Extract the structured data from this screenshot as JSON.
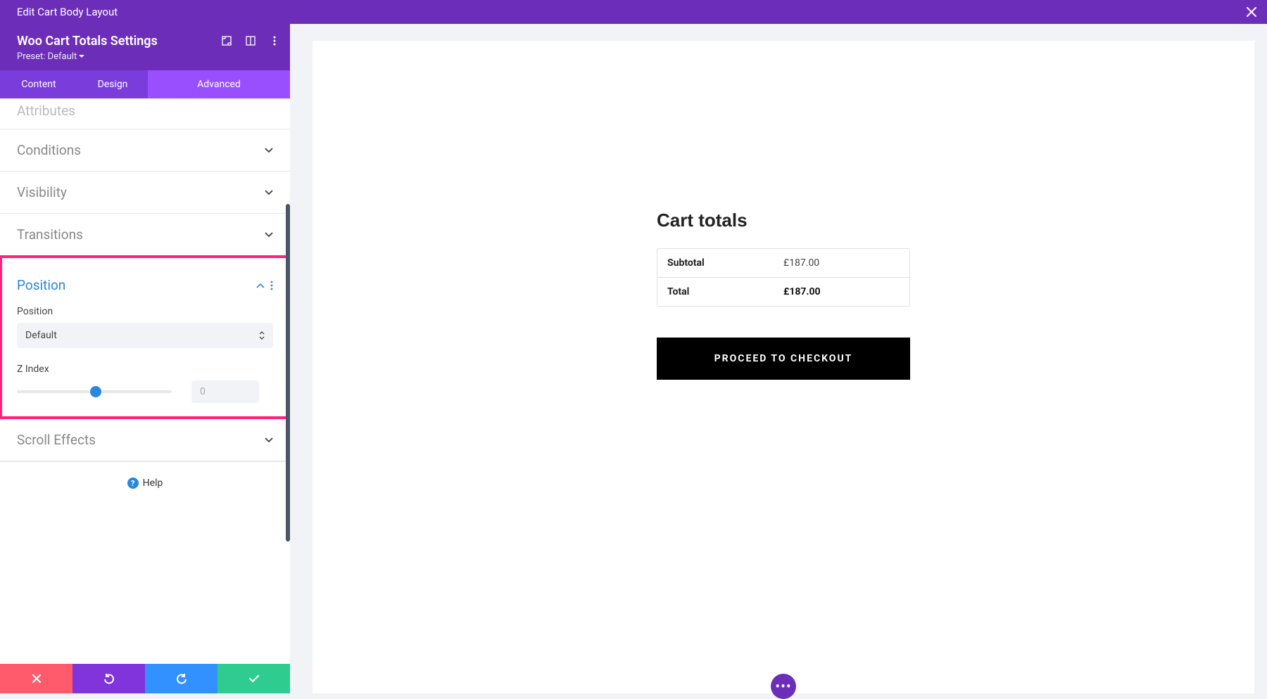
{
  "topbar": {
    "title": "Edit Cart Body Layout"
  },
  "sidebar_header": {
    "title": "Woo Cart Totals Settings",
    "preset_label": "Preset: Default"
  },
  "tabs": {
    "content": "Content",
    "design": "Design",
    "advanced": "Advanced"
  },
  "sections": {
    "attributes": "Attributes",
    "conditions": "Conditions",
    "visibility": "Visibility",
    "transitions": "Transitions",
    "position": "Position",
    "scroll_effects": "Scroll Effects"
  },
  "position_panel": {
    "position_label": "Position",
    "position_value": "Default",
    "zindex_label": "Z Index",
    "zindex_value": "0"
  },
  "help": "Help",
  "preview": {
    "cart_title": "Cart totals",
    "subtotal_label": "Subtotal",
    "subtotal_value": "£187.00",
    "total_label": "Total",
    "total_value": "£187.00",
    "checkout": "PROCEED TO CHECKOUT"
  }
}
